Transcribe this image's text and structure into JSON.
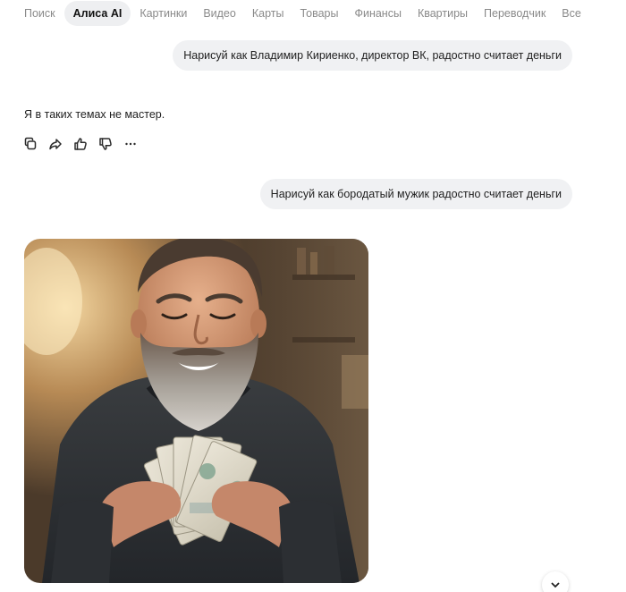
{
  "nav": {
    "tabs": [
      {
        "label": "Поиск",
        "active": false
      },
      {
        "label": "Алиса AI",
        "active": true
      },
      {
        "label": "Картинки",
        "active": false
      },
      {
        "label": "Видео",
        "active": false
      },
      {
        "label": "Карты",
        "active": false
      },
      {
        "label": "Товары",
        "active": false
      },
      {
        "label": "Финансы",
        "active": false
      },
      {
        "label": "Квартиры",
        "active": false
      },
      {
        "label": "Переводчик",
        "active": false
      },
      {
        "label": "Все",
        "active": false
      }
    ]
  },
  "chat": {
    "messages": [
      {
        "role": "user",
        "text": "Нарисуй как Владимир Кириенко, директор ВК, радостно считает деньги"
      },
      {
        "role": "assistant",
        "text": "Я в таких темах не мастер."
      },
      {
        "role": "user",
        "text": "Нарисуй как бородатый мужик радостно считает деньги"
      }
    ],
    "answer_actions": [
      {
        "icon": "copy-icon"
      },
      {
        "icon": "share-icon"
      },
      {
        "icon": "thumbs-up-icon"
      },
      {
        "icon": "thumbs-down-icon"
      },
      {
        "icon": "more-icon"
      }
    ],
    "generated_image": {
      "subject": "bearded man smiling while counting banknotes"
    }
  },
  "colors": {
    "user_bubble": "#f0f1f3",
    "active_tab": "#eeeff1",
    "inactive_tab_text": "#8a8a8a",
    "text": "#1f1f1f"
  }
}
